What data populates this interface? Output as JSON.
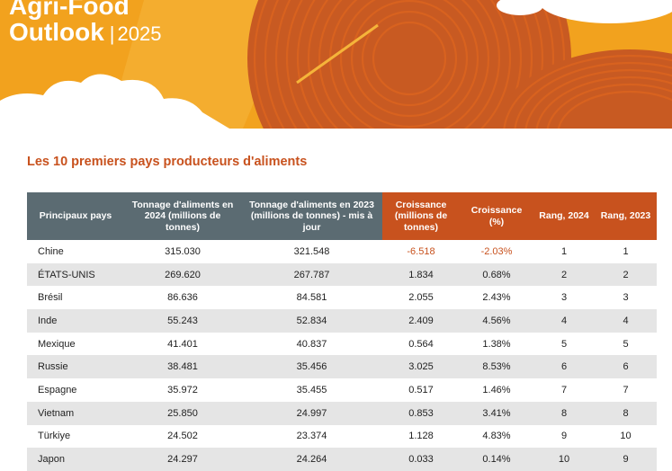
{
  "header": {
    "title_line1": "Agri-Food",
    "title_line2": "Outlook",
    "separator": "|",
    "year": "2025"
  },
  "colors": {
    "banner_orange": "#f2a21e",
    "accent_orange": "#c8521e",
    "header_gray": "#5b6b72",
    "row_shade": "#e5e5e5"
  },
  "section": {
    "title": "Les 10 premiers pays producteurs d'aliments"
  },
  "table": {
    "headers": [
      "Principaux pays",
      "Tonnage d'aliments en 2024 (millions de tonnes)",
      "Tonnage d'aliments en 2023 (millions de tonnes) - mis à jour",
      "Croissance (millions de tonnes)",
      "Croissance (%)",
      "Rang, 2024",
      "Rang, 2023"
    ],
    "rows": [
      [
        "Chine",
        "315.030",
        "321.548",
        "-6.518",
        "-2.03%",
        "1",
        "1"
      ],
      [
        "ÉTATS-UNIS",
        "269.620",
        "267.787",
        "1.834",
        "0.68%",
        "2",
        "2"
      ],
      [
        "Brésil",
        "86.636",
        "84.581",
        "2.055",
        "2.43%",
        "3",
        "3"
      ],
      [
        "Inde",
        "55.243",
        "52.834",
        "2.409",
        "4.56%",
        "4",
        "4"
      ],
      [
        "Mexique",
        "41.401",
        "40.837",
        "0.564",
        "1.38%",
        "5",
        "5"
      ],
      [
        "Russie",
        "38.481",
        "35.456",
        "3.025",
        "8.53%",
        "6",
        "6"
      ],
      [
        "Espagne",
        "35.972",
        "35.455",
        "0.517",
        "1.46%",
        "7",
        "7"
      ],
      [
        "Vietnam",
        "25.850",
        "24.997",
        "0.853",
        "3.41%",
        "8",
        "8"
      ],
      [
        "Türkiye",
        "24.502",
        "23.374",
        "1.128",
        "4.83%",
        "9",
        "10"
      ],
      [
        "Japon",
        "24.297",
        "24.264",
        "0.033",
        "0.14%",
        "10",
        "9"
      ]
    ]
  }
}
